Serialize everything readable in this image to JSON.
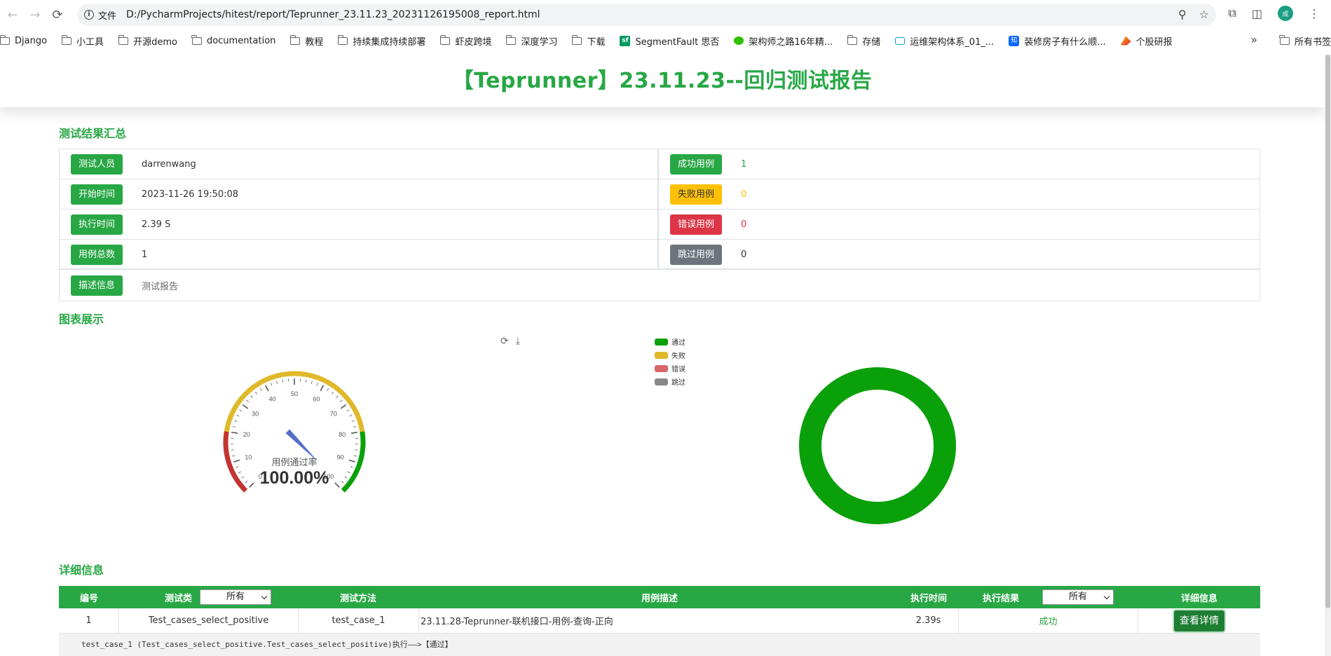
{
  "browser": {
    "file_label": "文件",
    "url": "D:/PycharmProjects/hitest/report/Teprunner_23.11.23_20231126195008_report.html",
    "avatar_text": "成",
    "bookmarks": [
      "Django",
      "小工具",
      "开源demo",
      "documentation",
      "教程",
      "持续集成持续部署",
      "虾皮跨境",
      "深度学习",
      "下载",
      "SegmentFault 思否",
      "架构师之路16年精...",
      "存储",
      "运维架构体系_01_...",
      "装修房子有什么顺...",
      "个股研报"
    ],
    "all_bookmarks": "所有书签"
  },
  "report": {
    "title": "【Teprunner】23.11.23--回归测试报告",
    "summary_title": "测试结果汇总",
    "tester_label": "测试人员",
    "tester": "darrenwang",
    "start_label": "开始时间",
    "start": "2023-11-26 19:50:08",
    "duration_label": "执行时间",
    "duration": "2.39 S",
    "total_label": "用例总数",
    "total": "1",
    "pass_label": "成功用例",
    "pass": "1",
    "fail_label": "失败用例",
    "fail": "0",
    "error_label": "错误用例",
    "error": "0",
    "skip_label": "跳过用例",
    "skip": "0",
    "desc_label": "描述信息",
    "desc": "测试报告",
    "chart_title": "图表展示",
    "details_title": "详细信息"
  },
  "chart_data": [
    {
      "type": "gauge",
      "title": "用例通过率",
      "value": 100.0,
      "value_text": "100.00%",
      "min": 0,
      "max": 100,
      "tick_labels": [
        "0",
        "10",
        "20",
        "30",
        "40",
        "50",
        "60",
        "70",
        "80",
        "90",
        "100"
      ],
      "bands": [
        {
          "from": 0,
          "to": 20,
          "color": "#c23531"
        },
        {
          "from": 20,
          "to": 80,
          "color": "#e0b92a"
        },
        {
          "from": 80,
          "to": 100,
          "color": "#0aa00a"
        }
      ]
    },
    {
      "type": "pie",
      "categories": [
        "通过",
        "失败",
        "错误",
        "跳过"
      ],
      "values": [
        1,
        0,
        0,
        0
      ],
      "colors": [
        "#0aa00a",
        "#e0b92a",
        "#d9666a",
        "#888888"
      ],
      "legend": "top-left"
    }
  ],
  "table": {
    "headers": [
      "编号",
      "测试类",
      "测试方法",
      "用例描述",
      "执行时间",
      "执行结果",
      "详细信息"
    ],
    "class_filter": "所有",
    "result_filter": "所有",
    "rows": [
      {
        "no": "1",
        "cls": "Test_cases_select_positive",
        "method": "test_case_1",
        "desc": "23.11.28-Teprunner-联机接口-用例-查询-正向",
        "time": "2.39s",
        "result": "成功",
        "action": "查看详情"
      }
    ],
    "log": "test_case_1 (Test_cases_select_positive.Test_cases_select_positive)执行——>【通过】"
  },
  "colors": {
    "accent": "#28a745",
    "pass": "#0aa00a",
    "needle": "#5470c6"
  }
}
